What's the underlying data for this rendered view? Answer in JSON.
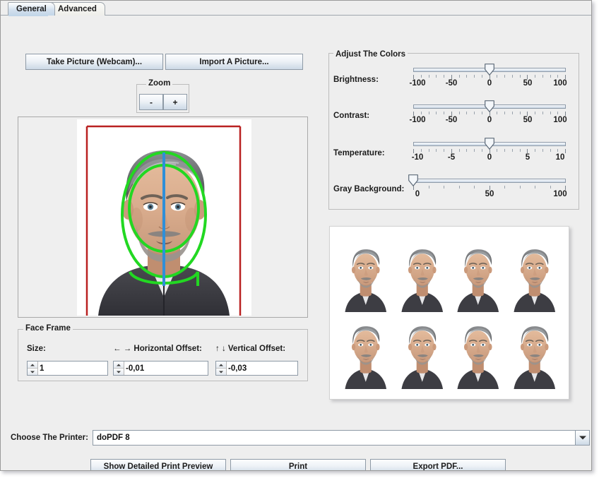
{
  "window": {
    "tabs": [
      {
        "label": "General",
        "active": true
      },
      {
        "label": "Advanced",
        "active": false
      }
    ]
  },
  "picture_actions": {
    "take_picture_label": "Take Picture (Webcam)...",
    "import_picture_label": "Import A Picture..."
  },
  "zoom": {
    "legend": "Zoom",
    "zoom_out_label": "-",
    "zoom_in_label": "+"
  },
  "preview": {
    "guide_rect_color": "#b92121",
    "face_oval_color": "#22d822",
    "center_line_color": "#2f8fd8"
  },
  "face_frame": {
    "legend": "Face Frame",
    "size_label": "Size:",
    "size_value": "1",
    "horizontal_offset_label": "← → Horizontal Offset:",
    "horizontal_offset_value": "-0,01",
    "vertical_offset_label": "↑ ↓ Vertical Offset:",
    "vertical_offset_value": "-0,03"
  },
  "adjust_colors": {
    "legend": "Adjust The Colors",
    "sliders": [
      {
        "label": "Brightness:",
        "value": 0,
        "min": -100,
        "max": 100,
        "scale": [
          "-100",
          "-50",
          "0",
          "50",
          "100"
        ],
        "minor_ticks": 21
      },
      {
        "label": "Contrast:",
        "value": 0,
        "min": -100,
        "max": 100,
        "scale": [
          "-100",
          "-50",
          "0",
          "50",
          "100"
        ],
        "minor_ticks": 21
      },
      {
        "label": "Temperature:",
        "value": 0,
        "min": -10,
        "max": 10,
        "scale": [
          "-10",
          "-5",
          "0",
          "5",
          "10"
        ],
        "minor_ticks": 21
      },
      {
        "label": "Gray Background:",
        "value": 0,
        "min": 0,
        "max": 100,
        "scale": [
          "0",
          "50",
          "100"
        ],
        "minor_ticks": 11
      }
    ]
  },
  "thumbnails": {
    "count": 8,
    "columns": 4,
    "rows": 2
  },
  "printer": {
    "label": "Choose The Printer:",
    "selected": "doPDF 8",
    "dropdown_icon": "chevron-down-icon"
  },
  "actions": {
    "preview_label": "Show Detailed Print Preview",
    "print_label": "Print",
    "export_label": "Export PDF..."
  }
}
